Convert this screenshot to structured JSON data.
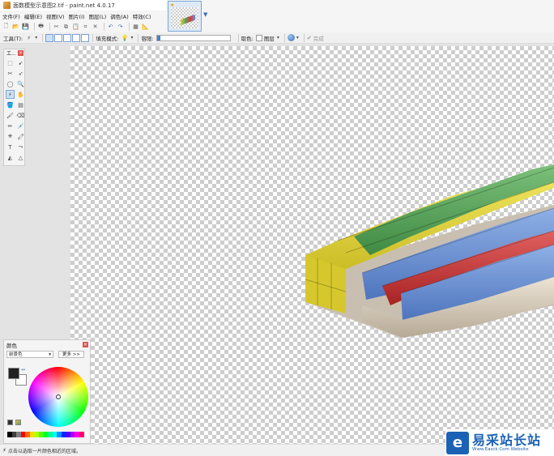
{
  "window": {
    "title": "面数模型示意图2.tif - paint.net 4.0.17"
  },
  "menu": [
    "文件(F)",
    "编辑(E)",
    "视图(V)",
    "图片(I)",
    "图层(L)",
    "调色(A)",
    "特效(C)"
  ],
  "toolbar2": {
    "tool_label": "工具(T):",
    "fill_mode_label": "填充模式:",
    "tolerance_label": "容限:",
    "tolerance_fraction": 0.05,
    "sampling_label": "取色:",
    "sampling_value": "图层",
    "finish_label": "完成"
  },
  "tools_panel": {
    "title": "工..."
  },
  "colors_panel": {
    "title": "颜色",
    "mode_select": "前景色",
    "more_button": "更多 >>",
    "primary_color": "#222222",
    "secondary_color": "#ffffff",
    "palette": [
      "#000000",
      "#404040",
      "#7f7f7f",
      "#ff0000",
      "#ff6a00",
      "#ffd800",
      "#b6ff00",
      "#4cff00",
      "#00ff21",
      "#00ff90",
      "#00ffff",
      "#0094ff",
      "#0026ff",
      "#4800ff",
      "#b200ff",
      "#ff00dc",
      "#ff006e",
      "#ffffff"
    ]
  },
  "status": {
    "text": "点击以选取一片颜色相近的区域。"
  },
  "watermark": {
    "logo_glyph": "e",
    "main": "易采站长站",
    "sub": "Www.Easck.Com  Website"
  },
  "colors": {
    "accent": "#1b62b5"
  }
}
